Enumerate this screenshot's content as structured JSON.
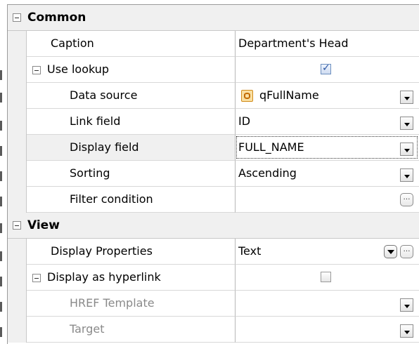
{
  "groups": {
    "common": {
      "title": "Common",
      "caption": {
        "label": "Caption",
        "value": "Department's Head"
      },
      "use_lookup": {
        "label": "Use lookup",
        "checked": true
      },
      "data_source": {
        "label": "Data source",
        "value": "qFullName",
        "icon": "dataset-icon"
      },
      "link_field": {
        "label": "Link field",
        "value": "ID"
      },
      "display_field": {
        "label": "Display field",
        "value": "FULL_NAME"
      },
      "sorting": {
        "label": "Sorting",
        "value": "Ascending"
      },
      "filter_condition": {
        "label": "Filter condition",
        "value": ""
      }
    },
    "view": {
      "title": "View",
      "display_properties": {
        "label": "Display Properties",
        "value": "Text"
      },
      "display_as_hyperlink": {
        "label": "Display as hyperlink",
        "checked": false
      },
      "href_template": {
        "label": "HREF Template",
        "value": ""
      },
      "target": {
        "label": "Target",
        "value": ""
      }
    }
  },
  "icons": {
    "collapse": "minus-box-icon",
    "dropdown": "chevron-down-icon",
    "ellipsis": "ellipsis-icon"
  },
  "colors": {
    "group_bg": "#f0f0f0",
    "grid_line": "#c8c8c8",
    "disabled_text": "#8a8a8a"
  }
}
